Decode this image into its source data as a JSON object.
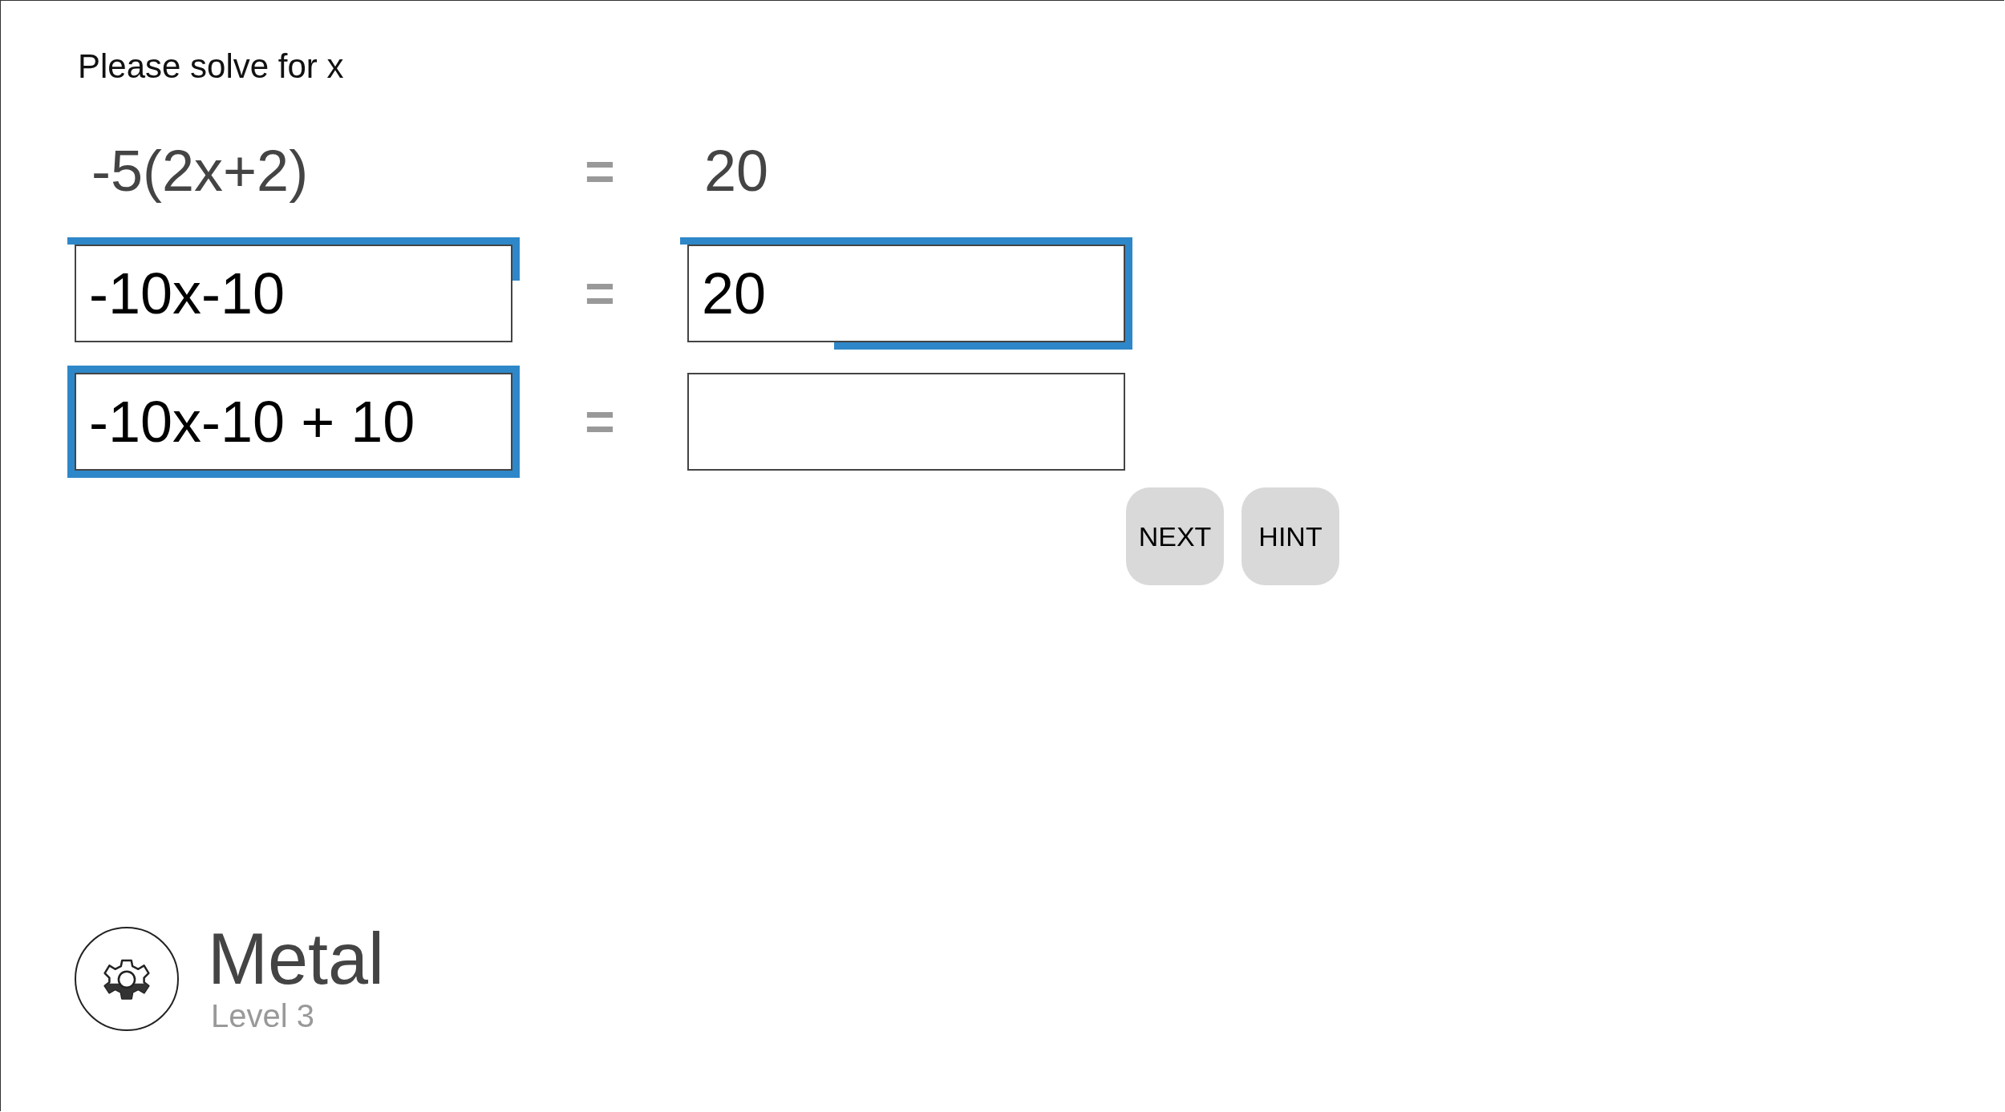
{
  "prompt": "Please solve for x",
  "rows": [
    {
      "left": {
        "kind": "text",
        "value": "-5(2x+2)"
      },
      "sign": "=",
      "right": {
        "kind": "text",
        "value": "20"
      }
    },
    {
      "left": {
        "kind": "field",
        "value": "-10x-10",
        "edge_top": true,
        "edge_right": true,
        "edge_bottom": false,
        "edge_left": false
      },
      "sign": "=",
      "right": {
        "kind": "field",
        "value": "20",
        "edge_top": true,
        "edge_right": true,
        "edge_bottom": true,
        "edge_left": false
      }
    },
    {
      "left": {
        "kind": "field",
        "value": "-10x-10 + 10",
        "edge_top": true,
        "edge_right": true,
        "edge_bottom": true,
        "edge_left": true
      },
      "sign": "=",
      "right": {
        "kind": "field",
        "edge_top": false,
        "edge_right": false,
        "edge_bottom": false,
        "edge_left": false
      }
    }
  ],
  "buttons": [
    "NEXT",
    "HINT"
  ],
  "badge": {
    "title": "Metal",
    "subtitle": "Level 3"
  }
}
